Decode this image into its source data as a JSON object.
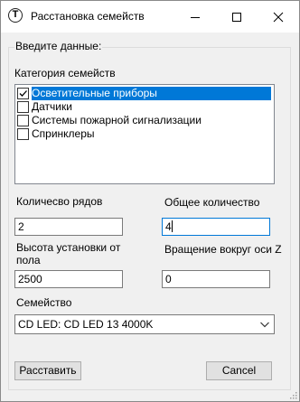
{
  "window": {
    "title": "Расстановка семейств"
  },
  "form": {
    "group_label": "Введите данные:",
    "category_label": "Категория семейств",
    "categories": [
      {
        "label": "Осветительные приборы",
        "checked": true,
        "selected": true
      },
      {
        "label": "Датчики",
        "checked": false,
        "selected": false
      },
      {
        "label": "Системы пожарной сигнализации",
        "checked": false,
        "selected": false
      },
      {
        "label": "Спринклеры",
        "checked": false,
        "selected": false
      }
    ],
    "rows_label": "Количесво рядов",
    "rows_value": "2",
    "total_label": "Общее количество",
    "total_value": "4",
    "height_label_line1": "Высота установки от",
    "height_label_line2": "пола",
    "height_value": "2500",
    "rotation_label": "Вращение вокруг оси Z",
    "rotation_value": "0",
    "family_label": "Семейство",
    "family_value": "CD LED: CD LED 13 4000K"
  },
  "buttons": {
    "place_label": "Расставить",
    "cancel_label": "Cancel"
  },
  "colors": {
    "selection": "#0078d7",
    "window_bg": "#f0f0f0",
    "titlebar_bg": "#ffffff"
  }
}
